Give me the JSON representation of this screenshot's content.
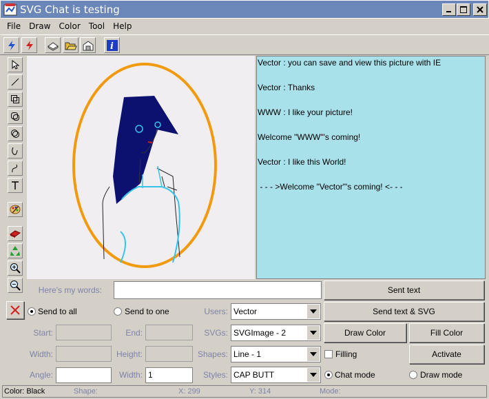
{
  "window": {
    "title": "SVG Chat is testing"
  },
  "menu": [
    "File",
    "Draw",
    "Color",
    "Tool",
    "Help"
  ],
  "toolbar": {
    "icons": [
      "connect-icon",
      "disconnect-icon",
      "new-icon",
      "open-icon",
      "save-icon",
      "info-icon"
    ]
  },
  "tools": [
    "select-arrow-icon",
    "line-tool-icon",
    "rectangle-tool-icon",
    "round-rect-tool-icon",
    "ellipse-tool-icon",
    "curve-tool-icon",
    "freehand-tool-icon",
    "text-tool-icon",
    "palette-icon",
    "eraser-icon",
    "recycle-icon",
    "zoom-in-icon",
    "zoom-out-icon"
  ],
  "chat": {
    "lines": [
      "Vector : you can save and view this picture with IE",
      "Vector : Thanks",
      "WWW : I like your picture!",
      "Welcome \"WWW\"'s coming!",
      "Vector : I like this World!",
      " - - - >Welcome \"Vector\"'s coming! <- - -"
    ]
  },
  "form": {
    "words_label": "Here's my words:",
    "words_value": "",
    "sent_text": "Sent text",
    "send_to_all": "Send to all",
    "send_to_one": "Send to one",
    "users_label": "Users:",
    "users_value": "Vector",
    "sent_text_svg": "Send text & SVG",
    "start_label": "Start:",
    "end_label": "End:",
    "svgs_label": "SVGs:",
    "svgs_value": "SVGImage - 2",
    "draw_color": "Draw Color",
    "fill_color": "Fill Color",
    "width_label": "Width:",
    "height_label": "Height:",
    "shapes_label": "Shapes:",
    "shapes_value": "Line - 1",
    "filling": "Filling",
    "activate": "Activate",
    "angle_label": "Angle:",
    "angle_value": "",
    "width2_label": "Width:",
    "width2_value": "1",
    "styles_label": "Styles:",
    "styles_value": "CAP BUTT",
    "chat_mode": "Chat mode",
    "draw_mode": "Draw mode"
  },
  "status": {
    "color": "Color: Black",
    "shape": "Shape:",
    "x": "X: 299",
    "y": "Y: 314",
    "mode": "Mode:"
  },
  "colors": {
    "titlebar": "#6b86b8",
    "chat_bg": "#a9e1ea",
    "canvas_bg": "#f1eef2",
    "ellipse": "#f29a0e",
    "hair": "#0c1170",
    "dress": "#34c4e8"
  }
}
